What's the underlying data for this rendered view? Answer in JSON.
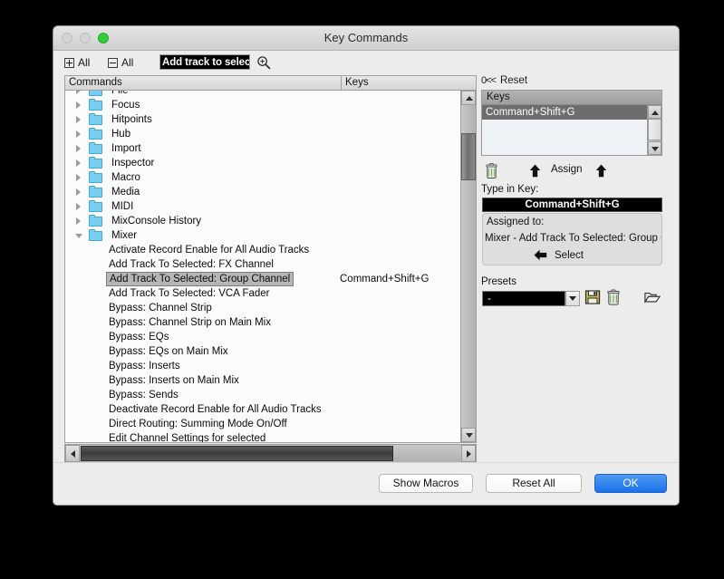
{
  "window": {
    "title": "Key Commands",
    "traffic_lights": [
      "close-button",
      "minimize-button",
      "maximize-button"
    ]
  },
  "toolbar": {
    "expand_all_label": "All",
    "collapse_all_label": "All",
    "search_value": "Add track to select",
    "search_icon": "magnifier-icon"
  },
  "left_pane": {
    "columns": {
      "commands": "Commands",
      "keys": "Keys"
    },
    "rows": [
      {
        "type": "folder",
        "label": "File",
        "expanded": false,
        "shortcut": ""
      },
      {
        "type": "folder",
        "label": "Focus",
        "expanded": false,
        "shortcut": ""
      },
      {
        "type": "folder",
        "label": "Hitpoints",
        "expanded": false,
        "shortcut": ""
      },
      {
        "type": "folder",
        "label": "Hub",
        "expanded": false,
        "shortcut": ""
      },
      {
        "type": "folder",
        "label": "Import",
        "expanded": false,
        "shortcut": ""
      },
      {
        "type": "folder",
        "label": "Inspector",
        "expanded": false,
        "shortcut": ""
      },
      {
        "type": "folder",
        "label": "Macro",
        "expanded": false,
        "shortcut": ""
      },
      {
        "type": "folder",
        "label": "Media",
        "expanded": false,
        "shortcut": ""
      },
      {
        "type": "folder",
        "label": "MIDI",
        "expanded": false,
        "shortcut": ""
      },
      {
        "type": "folder",
        "label": "MixConsole History",
        "expanded": false,
        "shortcut": ""
      },
      {
        "type": "folder",
        "label": "Mixer",
        "expanded": true,
        "shortcut": ""
      },
      {
        "type": "command",
        "label": "Activate Record Enable for All Audio Tracks",
        "shortcut": ""
      },
      {
        "type": "command",
        "label": "Add Track To Selected: FX Channel",
        "shortcut": ""
      },
      {
        "type": "command",
        "label": "Add Track To Selected: Group Channel",
        "shortcut": "Command+Shift+G",
        "selected": true
      },
      {
        "type": "command",
        "label": "Add Track To Selected: VCA Fader",
        "shortcut": ""
      },
      {
        "type": "command",
        "label": "Bypass: Channel Strip",
        "shortcut": ""
      },
      {
        "type": "command",
        "label": "Bypass: Channel Strip on Main Mix",
        "shortcut": ""
      },
      {
        "type": "command",
        "label": "Bypass: EQs",
        "shortcut": ""
      },
      {
        "type": "command",
        "label": "Bypass: EQs on Main Mix",
        "shortcut": ""
      },
      {
        "type": "command",
        "label": "Bypass: Inserts",
        "shortcut": ""
      },
      {
        "type": "command",
        "label": "Bypass: Inserts on Main Mix",
        "shortcut": ""
      },
      {
        "type": "command",
        "label": "Bypass: Sends",
        "shortcut": ""
      },
      {
        "type": "command",
        "label": "Deactivate Record Enable for All Audio Tracks",
        "shortcut": ""
      },
      {
        "type": "command",
        "label": "Direct Routing: Summing Mode On/Off",
        "shortcut": ""
      },
      {
        "type": "command",
        "label": "Edit Channel Settings for selected",
        "shortcut": ""
      }
    ]
  },
  "right_pane": {
    "reset_glyph": "0<<",
    "reset_label": "Reset",
    "keys_header": "Keys",
    "keys_rows": [
      {
        "label": "Command+Shift+G",
        "selected": true
      }
    ],
    "assign_label": "Assign",
    "trash_icon": "trash-icon",
    "up_arrow_icon": "arrow-up-icon",
    "type_in_key_label": "Type in Key:",
    "type_in_key_value": "Command+Shift+G",
    "assigned_to_label": "Assigned to:",
    "assigned_to_value": "Mixer - Add Track To Selected: Group C",
    "select_label": "Select",
    "left_arrow_icon": "arrow-left-icon",
    "presets_label": "Presets",
    "preset_value": "-",
    "preset_dropdown_icon": "chevron-down-icon",
    "preset_save_icon": "save-floppy-icon",
    "preset_delete_icon": "trash-icon",
    "preset_open_icon": "folder-open-icon"
  },
  "footer": {
    "show_macros": "Show Macros",
    "reset_all": "Reset All",
    "ok": "OK"
  },
  "colors": {
    "accent_blue": "#1a71e8",
    "folder_blue": "#77cdf2",
    "selection_gray": "#b6b6b6",
    "keys_selection": "#6d6d6d",
    "window_bg": "#ececec"
  }
}
